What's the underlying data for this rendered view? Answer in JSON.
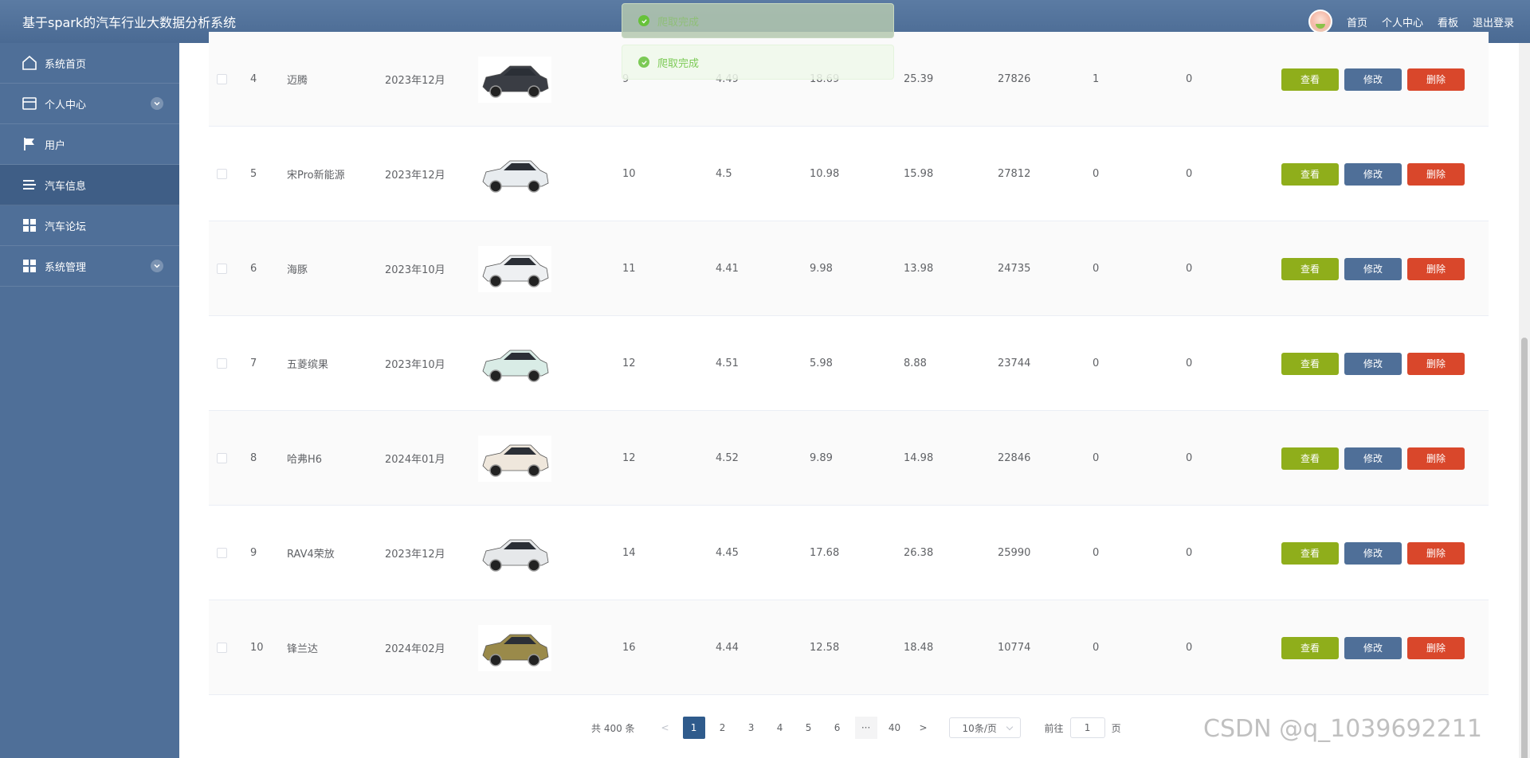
{
  "header": {
    "title": "基于spark的汽车行业大数据分析系统",
    "links": [
      "首页",
      "个人中心",
      "看板",
      "退出登录"
    ]
  },
  "sidebar": {
    "items": [
      {
        "label": "系统首页",
        "icon": "home-icon",
        "expandable": false,
        "active": false
      },
      {
        "label": "个人中心",
        "icon": "profile-icon",
        "expandable": true,
        "active": false
      },
      {
        "label": "用户",
        "icon": "flag-icon",
        "expandable": false,
        "active": false
      },
      {
        "label": "汽车信息",
        "icon": "list-icon",
        "expandable": false,
        "active": true
      },
      {
        "label": "汽车论坛",
        "icon": "grid-icon",
        "expandable": false,
        "active": false
      },
      {
        "label": "系统管理",
        "icon": "grid-icon",
        "expandable": true,
        "active": false
      }
    ]
  },
  "toasts": [
    "爬取完成",
    "爬取完成"
  ],
  "table": {
    "actions": {
      "view": "查看",
      "edit": "修改",
      "delete": "删除"
    },
    "rows": [
      {
        "index": "4",
        "name": "迈腾",
        "date": "2023年12月",
        "car_color": "#3a3d44",
        "c1": "9",
        "c2": "4.49",
        "c3": "18.69",
        "c4": "25.39",
        "c5": "27826",
        "c6": "1",
        "c7": "0"
      },
      {
        "index": "5",
        "name": "宋Pro新能源",
        "date": "2023年12月",
        "car_color": "#e8ecef",
        "c1": "10",
        "c2": "4.5",
        "c3": "10.98",
        "c4": "15.98",
        "c5": "27812",
        "c6": "0",
        "c7": "0"
      },
      {
        "index": "6",
        "name": "海豚",
        "date": "2023年10月",
        "car_color": "#eef0f2",
        "c1": "11",
        "c2": "4.41",
        "c3": "9.98",
        "c4": "13.98",
        "c5": "24735",
        "c6": "0",
        "c7": "0"
      },
      {
        "index": "7",
        "name": "五菱缤果",
        "date": "2023年10月",
        "car_color": "#d9ece6",
        "c1": "12",
        "c2": "4.51",
        "c3": "5.98",
        "c4": "8.88",
        "c5": "23744",
        "c6": "0",
        "c7": "0"
      },
      {
        "index": "8",
        "name": "哈弗H6",
        "date": "2024年01月",
        "car_color": "#efe7dc",
        "c1": "12",
        "c2": "4.52",
        "c3": "9.89",
        "c4": "14.98",
        "c5": "22846",
        "c6": "0",
        "c7": "0"
      },
      {
        "index": "9",
        "name": "RAV4荣放",
        "date": "2023年12月",
        "car_color": "#e6e8ea",
        "c1": "14",
        "c2": "4.45",
        "c3": "17.68",
        "c4": "26.38",
        "c5": "25990",
        "c6": "0",
        "c7": "0"
      },
      {
        "index": "10",
        "name": "锋兰达",
        "date": "2024年02月",
        "car_color": "#9a8a4a",
        "c1": "16",
        "c2": "4.44",
        "c3": "12.58",
        "c4": "18.48",
        "c5": "10774",
        "c6": "0",
        "c7": "0"
      }
    ]
  },
  "pagination": {
    "total": "共 400 条",
    "prev": "<",
    "pages": [
      "1",
      "2",
      "3",
      "4",
      "5",
      "6"
    ],
    "more": "···",
    "last": "40",
    "next": ">",
    "current": "1",
    "page_size": "10条/页",
    "goto_label": "前往",
    "goto_value": "1",
    "goto_suffix": "页"
  },
  "watermark": "CSDN @q_1039692211"
}
